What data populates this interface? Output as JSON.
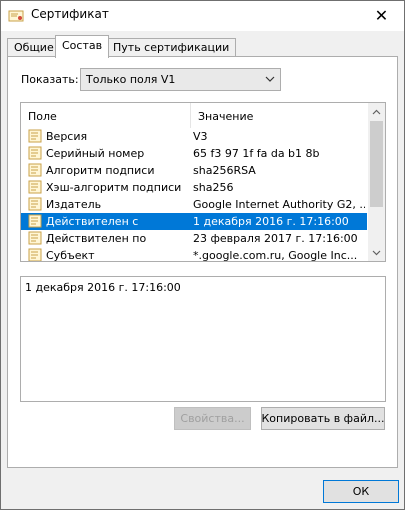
{
  "window": {
    "title": "Сертификат",
    "close_glyph": "✕"
  },
  "tabs": [
    {
      "label": "Общие"
    },
    {
      "label": "Состав"
    },
    {
      "label": "Путь сертификации"
    }
  ],
  "show": {
    "label": "Показать:",
    "selected": "Только поля V1"
  },
  "list": {
    "columns": [
      "Поле",
      "Значение"
    ],
    "rows": [
      {
        "field": "Версия",
        "value": "V3"
      },
      {
        "field": "Серийный номер",
        "value": "65 f3 97 1f fa da b1 8b"
      },
      {
        "field": "Алгоритм подписи",
        "value": "sha256RSA"
      },
      {
        "field": "Хэш-алгоритм подписи",
        "value": "sha256"
      },
      {
        "field": "Издатель",
        "value": "Google Internet Authority G2, ..."
      },
      {
        "field": "Действителен с",
        "value": "1 декабря 2016 г. 17:16:00"
      },
      {
        "field": "Действителен по",
        "value": "23 февраля 2017 г. 17:16:00"
      },
      {
        "field": "Субъект",
        "value": "*.google.com.ru, Google Inc..."
      }
    ],
    "selected_index": 5
  },
  "detail": {
    "text": "1 декабря 2016 г. 17:16:00"
  },
  "buttons": {
    "properties": "Свойства...",
    "copy": "Копировать в файл...",
    "ok": "ОК"
  },
  "colors": {
    "selection": "#0078d7",
    "focus_border": "#0078d7"
  }
}
